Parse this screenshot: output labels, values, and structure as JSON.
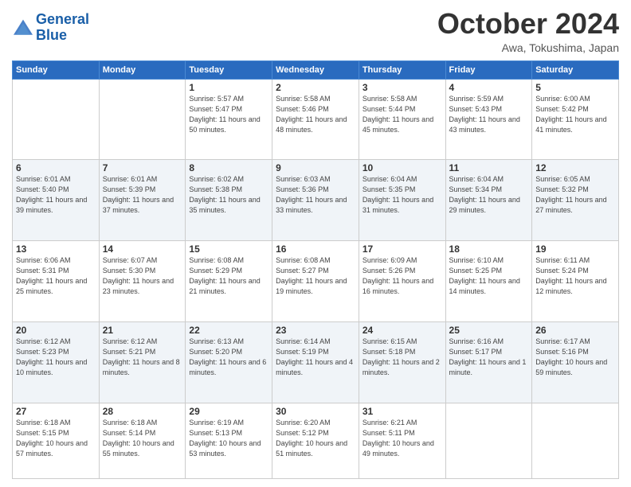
{
  "header": {
    "logo_line1": "General",
    "logo_line2": "Blue",
    "month": "October 2024",
    "location": "Awa, Tokushima, Japan"
  },
  "weekdays": [
    "Sunday",
    "Monday",
    "Tuesday",
    "Wednesday",
    "Thursday",
    "Friday",
    "Saturday"
  ],
  "weeks": [
    [
      {
        "day": "",
        "info": ""
      },
      {
        "day": "",
        "info": ""
      },
      {
        "day": "1",
        "info": "Sunrise: 5:57 AM\nSunset: 5:47 PM\nDaylight: 11 hours and 50 minutes."
      },
      {
        "day": "2",
        "info": "Sunrise: 5:58 AM\nSunset: 5:46 PM\nDaylight: 11 hours and 48 minutes."
      },
      {
        "day": "3",
        "info": "Sunrise: 5:58 AM\nSunset: 5:44 PM\nDaylight: 11 hours and 45 minutes."
      },
      {
        "day": "4",
        "info": "Sunrise: 5:59 AM\nSunset: 5:43 PM\nDaylight: 11 hours and 43 minutes."
      },
      {
        "day": "5",
        "info": "Sunrise: 6:00 AM\nSunset: 5:42 PM\nDaylight: 11 hours and 41 minutes."
      }
    ],
    [
      {
        "day": "6",
        "info": "Sunrise: 6:01 AM\nSunset: 5:40 PM\nDaylight: 11 hours and 39 minutes."
      },
      {
        "day": "7",
        "info": "Sunrise: 6:01 AM\nSunset: 5:39 PM\nDaylight: 11 hours and 37 minutes."
      },
      {
        "day": "8",
        "info": "Sunrise: 6:02 AM\nSunset: 5:38 PM\nDaylight: 11 hours and 35 minutes."
      },
      {
        "day": "9",
        "info": "Sunrise: 6:03 AM\nSunset: 5:36 PM\nDaylight: 11 hours and 33 minutes."
      },
      {
        "day": "10",
        "info": "Sunrise: 6:04 AM\nSunset: 5:35 PM\nDaylight: 11 hours and 31 minutes."
      },
      {
        "day": "11",
        "info": "Sunrise: 6:04 AM\nSunset: 5:34 PM\nDaylight: 11 hours and 29 minutes."
      },
      {
        "day": "12",
        "info": "Sunrise: 6:05 AM\nSunset: 5:32 PM\nDaylight: 11 hours and 27 minutes."
      }
    ],
    [
      {
        "day": "13",
        "info": "Sunrise: 6:06 AM\nSunset: 5:31 PM\nDaylight: 11 hours and 25 minutes."
      },
      {
        "day": "14",
        "info": "Sunrise: 6:07 AM\nSunset: 5:30 PM\nDaylight: 11 hours and 23 minutes."
      },
      {
        "day": "15",
        "info": "Sunrise: 6:08 AM\nSunset: 5:29 PM\nDaylight: 11 hours and 21 minutes."
      },
      {
        "day": "16",
        "info": "Sunrise: 6:08 AM\nSunset: 5:27 PM\nDaylight: 11 hours and 19 minutes."
      },
      {
        "day": "17",
        "info": "Sunrise: 6:09 AM\nSunset: 5:26 PM\nDaylight: 11 hours and 16 minutes."
      },
      {
        "day": "18",
        "info": "Sunrise: 6:10 AM\nSunset: 5:25 PM\nDaylight: 11 hours and 14 minutes."
      },
      {
        "day": "19",
        "info": "Sunrise: 6:11 AM\nSunset: 5:24 PM\nDaylight: 11 hours and 12 minutes."
      }
    ],
    [
      {
        "day": "20",
        "info": "Sunrise: 6:12 AM\nSunset: 5:23 PM\nDaylight: 11 hours and 10 minutes."
      },
      {
        "day": "21",
        "info": "Sunrise: 6:12 AM\nSunset: 5:21 PM\nDaylight: 11 hours and 8 minutes."
      },
      {
        "day": "22",
        "info": "Sunrise: 6:13 AM\nSunset: 5:20 PM\nDaylight: 11 hours and 6 minutes."
      },
      {
        "day": "23",
        "info": "Sunrise: 6:14 AM\nSunset: 5:19 PM\nDaylight: 11 hours and 4 minutes."
      },
      {
        "day": "24",
        "info": "Sunrise: 6:15 AM\nSunset: 5:18 PM\nDaylight: 11 hours and 2 minutes."
      },
      {
        "day": "25",
        "info": "Sunrise: 6:16 AM\nSunset: 5:17 PM\nDaylight: 11 hours and 1 minute."
      },
      {
        "day": "26",
        "info": "Sunrise: 6:17 AM\nSunset: 5:16 PM\nDaylight: 10 hours and 59 minutes."
      }
    ],
    [
      {
        "day": "27",
        "info": "Sunrise: 6:18 AM\nSunset: 5:15 PM\nDaylight: 10 hours and 57 minutes."
      },
      {
        "day": "28",
        "info": "Sunrise: 6:18 AM\nSunset: 5:14 PM\nDaylight: 10 hours and 55 minutes."
      },
      {
        "day": "29",
        "info": "Sunrise: 6:19 AM\nSunset: 5:13 PM\nDaylight: 10 hours and 53 minutes."
      },
      {
        "day": "30",
        "info": "Sunrise: 6:20 AM\nSunset: 5:12 PM\nDaylight: 10 hours and 51 minutes."
      },
      {
        "day": "31",
        "info": "Sunrise: 6:21 AM\nSunset: 5:11 PM\nDaylight: 10 hours and 49 minutes."
      },
      {
        "day": "",
        "info": ""
      },
      {
        "day": "",
        "info": ""
      }
    ]
  ]
}
